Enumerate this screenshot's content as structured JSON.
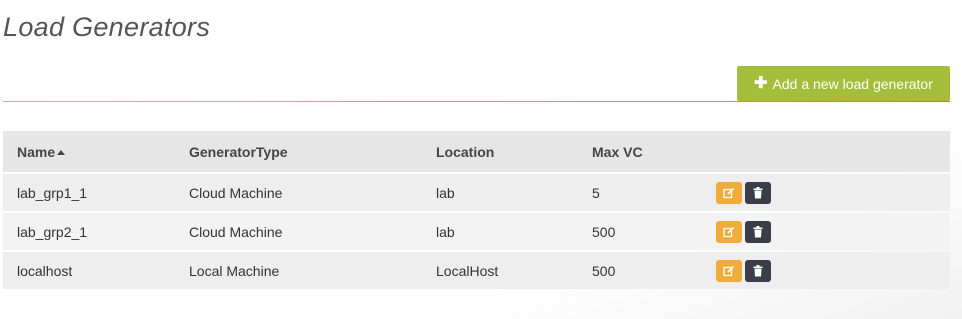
{
  "page": {
    "title": "Load Generators"
  },
  "toolbar": {
    "add_label": "Add a new load generator",
    "add_icon": "plus-icon"
  },
  "table": {
    "columns": {
      "name": "Name",
      "type": "GeneratorType",
      "location": "Location",
      "max_vc": "Max VC"
    },
    "sort": {
      "column": "name",
      "direction": "ascending"
    },
    "rows": [
      {
        "name": "lab_grp1_1",
        "type": "Cloud Machine",
        "location": "lab",
        "max_vc": "5"
      },
      {
        "name": "lab_grp2_1",
        "type": "Cloud Machine",
        "location": "lab",
        "max_vc": "500"
      },
      {
        "name": "localhost",
        "type": "Local Machine",
        "location": "LocalHost",
        "max_vc": "500"
      }
    ],
    "actions": {
      "edit_icon": "edit-icon",
      "delete_icon": "trash-icon"
    }
  },
  "colors": {
    "accent": "#a4bd3b",
    "edit": "#f0ad3c",
    "delete": "#3d3d4a",
    "divider": "#d4a63a"
  }
}
